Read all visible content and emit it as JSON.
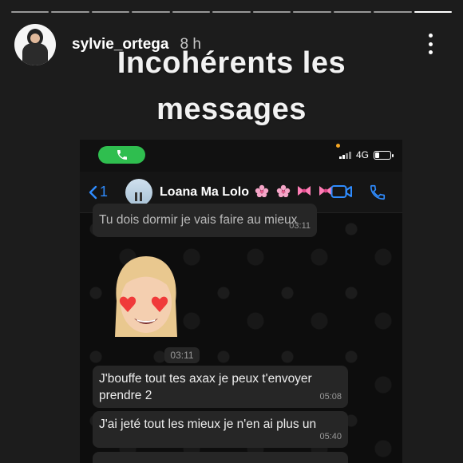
{
  "story": {
    "username": "sylvie_ortega",
    "time_ago": "8 h",
    "caption_line1": "Incohérents les",
    "caption_line2": "messages",
    "progress_segments": 11,
    "active_segment": 11
  },
  "phone": {
    "status": {
      "network": "4G",
      "call_active": true,
      "battery_level": 0.3
    },
    "chat": {
      "back_count": "1",
      "contact_name": "Loana Ma Lolo",
      "contact_emojis": [
        "cherry-blossom",
        "cherry-blossom",
        "ribbon",
        "ribbon"
      ],
      "messages": [
        {
          "text": "Tu dois dormir je vais faire au mieux",
          "time": "03:11",
          "partial": true
        },
        {
          "type": "sticker",
          "name": "memoji-heart-eyes",
          "time": "03:11"
        },
        {
          "text": "J'bouffe tout tes axax je peux t'envoyer prendre 2",
          "time": "05:08"
        },
        {
          "text": "J'ai jeté tout les mieux je n'en ai plus un",
          "time": "05:40"
        }
      ]
    }
  },
  "colors": {
    "accent_blue": "#2f8cff",
    "call_green": "#2fbe4f",
    "bubble_bg": "#262626"
  },
  "icons": [
    "menu-dots-icon",
    "phone-icon",
    "chevron-left-icon",
    "video-call-icon",
    "voice-call-icon",
    "signal-icon",
    "battery-icon"
  ]
}
